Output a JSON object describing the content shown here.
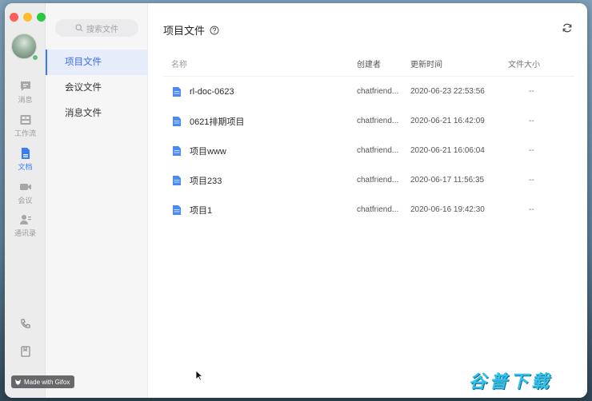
{
  "window": {
    "traffic_colors": [
      "#fc5f57",
      "#fdbc2e",
      "#28c840"
    ]
  },
  "rail": {
    "items": [
      {
        "label": "消息",
        "icon": "chat-icon"
      },
      {
        "label": "工作流",
        "icon": "workflow-icon"
      },
      {
        "label": "文档",
        "icon": "document-icon"
      },
      {
        "label": "会议",
        "icon": "video-icon"
      },
      {
        "label": "通讯录",
        "icon": "contacts-icon"
      }
    ],
    "active": "文档",
    "accent": "#3a7bf6"
  },
  "subnav": {
    "search_placeholder": "搜索文件",
    "items": [
      {
        "label": "项目文件"
      },
      {
        "label": "会议文件"
      },
      {
        "label": "消息文件"
      }
    ],
    "active": "项目文件"
  },
  "main": {
    "title": "项目文件",
    "columns": {
      "name": "名称",
      "creator": "创建者",
      "updated": "更新时间",
      "size": "文件大小"
    },
    "rows": [
      {
        "name": "rl-doc-0623",
        "creator": "chatfriend...",
        "updated": "2020-06-23 22:53:56",
        "size": "--"
      },
      {
        "name": "0621排期项目",
        "creator": "chatfriend...",
        "updated": "2020-06-21 16:42:09",
        "size": "--"
      },
      {
        "name": "项目www",
        "creator": "chatfriend...",
        "updated": "2020-06-21 16:06:04",
        "size": "--"
      },
      {
        "name": "项目233",
        "creator": "chatfriend...",
        "updated": "2020-06-17 11:56:35",
        "size": "--"
      },
      {
        "name": "项目1",
        "creator": "chatfriend...",
        "updated": "2020-06-16 19:42:30",
        "size": "--"
      }
    ]
  },
  "overlay": {
    "watermark": "Made with Gifox",
    "brand": "谷普下载"
  }
}
